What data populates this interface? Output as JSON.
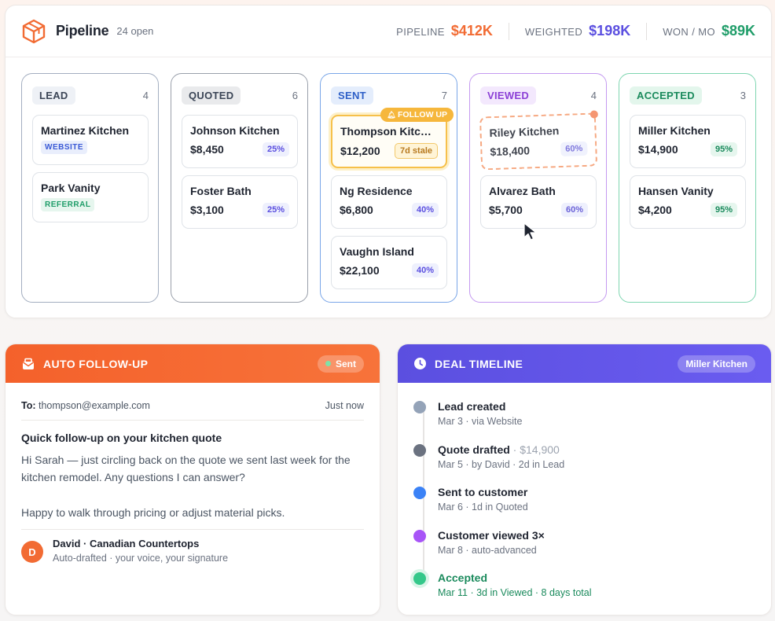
{
  "header": {
    "title": "Pipeline",
    "open_count": "24 open",
    "metrics": [
      {
        "label": "PIPELINE",
        "value": "$412K",
        "color": "#f26b33"
      },
      {
        "label": "WEIGHTED",
        "value": "$198K",
        "color": "#5b4fe0"
      },
      {
        "label": "WON / MO",
        "value": "$89K",
        "color": "#1f9d69"
      }
    ]
  },
  "columns": [
    {
      "tag": "LEAD",
      "count": "4",
      "border": "#a3aec0",
      "tag_bg": "#eef1f6",
      "tag_fg": "#3b4556",
      "deals": [
        {
          "name": "Martinez Kitchen",
          "source": "WEBSITE",
          "source_bg": "#e9eefc",
          "source_fg": "#3a5ad6"
        },
        {
          "name": "Park Vanity",
          "source": "REFERRAL",
          "source_bg": "#e6f6ee",
          "source_fg": "#1f9d69"
        }
      ]
    },
    {
      "tag": "QUOTED",
      "count": "6",
      "border": "#9aa0ab",
      "tag_bg": "#e9eaec",
      "tag_fg": "#3b4556",
      "deals": [
        {
          "name": "Johnson Kitchen",
          "amount": "$8,450",
          "pct": "25%"
        },
        {
          "name": "Foster Bath",
          "amount": "$3,100",
          "pct": "25%"
        }
      ]
    },
    {
      "tag": "SENT",
      "count": "7",
      "border": "#7aa6e8",
      "tag_bg": "#e4edfc",
      "tag_fg": "#2d5fc7",
      "deals": [
        {
          "name": "Thompson Kitchen",
          "amount": "$12,200",
          "stale": "7d stale",
          "follow_up": "FOLLOW UP"
        },
        {
          "name": "Ng Residence",
          "amount": "$6,800",
          "pct": "40%"
        },
        {
          "name": "Vaughn Island",
          "amount": "$22,100",
          "pct": "40%"
        }
      ]
    },
    {
      "tag": "VIEWED",
      "count": "4",
      "border": "#c49af0",
      "tag_bg": "#f3e8fd",
      "tag_fg": "#8b3fd6",
      "deals": [
        {
          "name": "Riley Kitchen",
          "amount": "$18,400",
          "pct": "60%"
        },
        {
          "name": "Alvarez Bath",
          "amount": "$5,700",
          "pct": "60%"
        }
      ]
    },
    {
      "tag": "ACCEPTED",
      "count": "3",
      "border": "#7fd6b1",
      "tag_bg": "#e3f6ec",
      "tag_fg": "#1a8a5c",
      "deals": [
        {
          "name": "Miller Kitchen",
          "amount": "$14,900",
          "pct": "95%"
        },
        {
          "name": "Hansen Vanity",
          "amount": "$4,200",
          "pct": "95%"
        }
      ]
    }
  ],
  "followup": {
    "title": "AUTO FOLLOW-UP",
    "status": "Sent",
    "to_label": "To:",
    "to_email": "thompson@example.com",
    "time": "Just now",
    "subject": "Quick follow-up on your kitchen quote",
    "body_1": "Hi Sarah — just circling back on the quote we sent last week for the kitchen remodel. Any questions I can answer?",
    "body_2": "Happy to walk through pricing or adjust material picks.",
    "avatar_initial": "D",
    "sig_name": "David · Canadian Countertops",
    "sig_sub": "Auto-drafted · your voice, your signature"
  },
  "timeline": {
    "title": "DEAL TIMELINE",
    "deal": "Miller Kitchen",
    "events": [
      {
        "title": "Lead created",
        "extra": "",
        "sub": "Mar 3 · via Website",
        "color": "#94a3b8"
      },
      {
        "title": "Quote drafted",
        "extra": " · $14,900",
        "sub": "Mar 5 · by David · 2d in Lead",
        "color": "#6b7280"
      },
      {
        "title": "Sent to customer",
        "extra": "",
        "sub": "Mar 6 · 1d in Quoted",
        "color": "#3b82f6"
      },
      {
        "title": "Customer viewed 3×",
        "extra": "",
        "sub": "Mar 8 · auto-advanced",
        "color": "#a855f7"
      },
      {
        "title": "Accepted",
        "extra": "",
        "sub": "Mar 11 · 3d in Viewed · 8 days total",
        "color": "#34c88a"
      }
    ]
  }
}
